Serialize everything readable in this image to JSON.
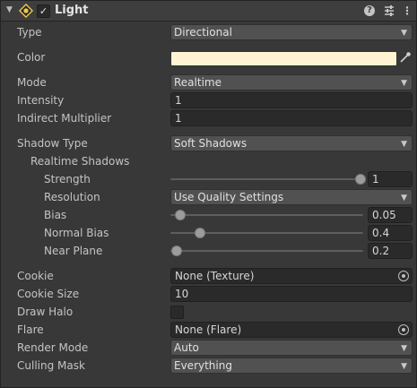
{
  "header": {
    "title": "Light",
    "foldout_icon": "triangle-down-icon",
    "help_glyph": "?",
    "kebab_glyph": "⋮"
  },
  "rows": {
    "type": {
      "label": "Type",
      "value": "Directional"
    },
    "color": {
      "label": "Color",
      "value": "#fff3d2"
    },
    "mode": {
      "label": "Mode",
      "value": "Realtime"
    },
    "intensity": {
      "label": "Intensity",
      "value": "1"
    },
    "indirect_multiplier": {
      "label": "Indirect Multiplier",
      "value": "1"
    },
    "shadow_type": {
      "label": "Shadow Type",
      "value": "Soft Shadows"
    },
    "realtime_shadows": {
      "label": "Realtime Shadows"
    },
    "strength": {
      "label": "Strength",
      "value": "1",
      "fraction": 1.0
    },
    "resolution": {
      "label": "Resolution",
      "value": "Use Quality Settings"
    },
    "bias": {
      "label": "Bias",
      "value": "0.05",
      "fraction": 0.025
    },
    "normal_bias": {
      "label": "Normal Bias",
      "value": "0.4",
      "fraction": 0.13
    },
    "near_plane": {
      "label": "Near Plane",
      "value": "0.2",
      "fraction": 0.0
    },
    "cookie": {
      "label": "Cookie",
      "value": "None (Texture)"
    },
    "cookie_size": {
      "label": "Cookie Size",
      "value": "10"
    },
    "draw_halo": {
      "label": "Draw Halo",
      "checked": false
    },
    "flare": {
      "label": "Flare",
      "value": "None (Flare)"
    },
    "render_mode": {
      "label": "Render Mode",
      "value": "Auto"
    },
    "culling_mask": {
      "label": "Culling Mask",
      "value": "Everything"
    }
  },
  "colors": {
    "panel": "#383838",
    "header": "#3e3e3e",
    "dropdown": "#515151",
    "field": "#2a2a2a",
    "text": "#c4c4c4",
    "light_icon": "#f2c94c"
  }
}
